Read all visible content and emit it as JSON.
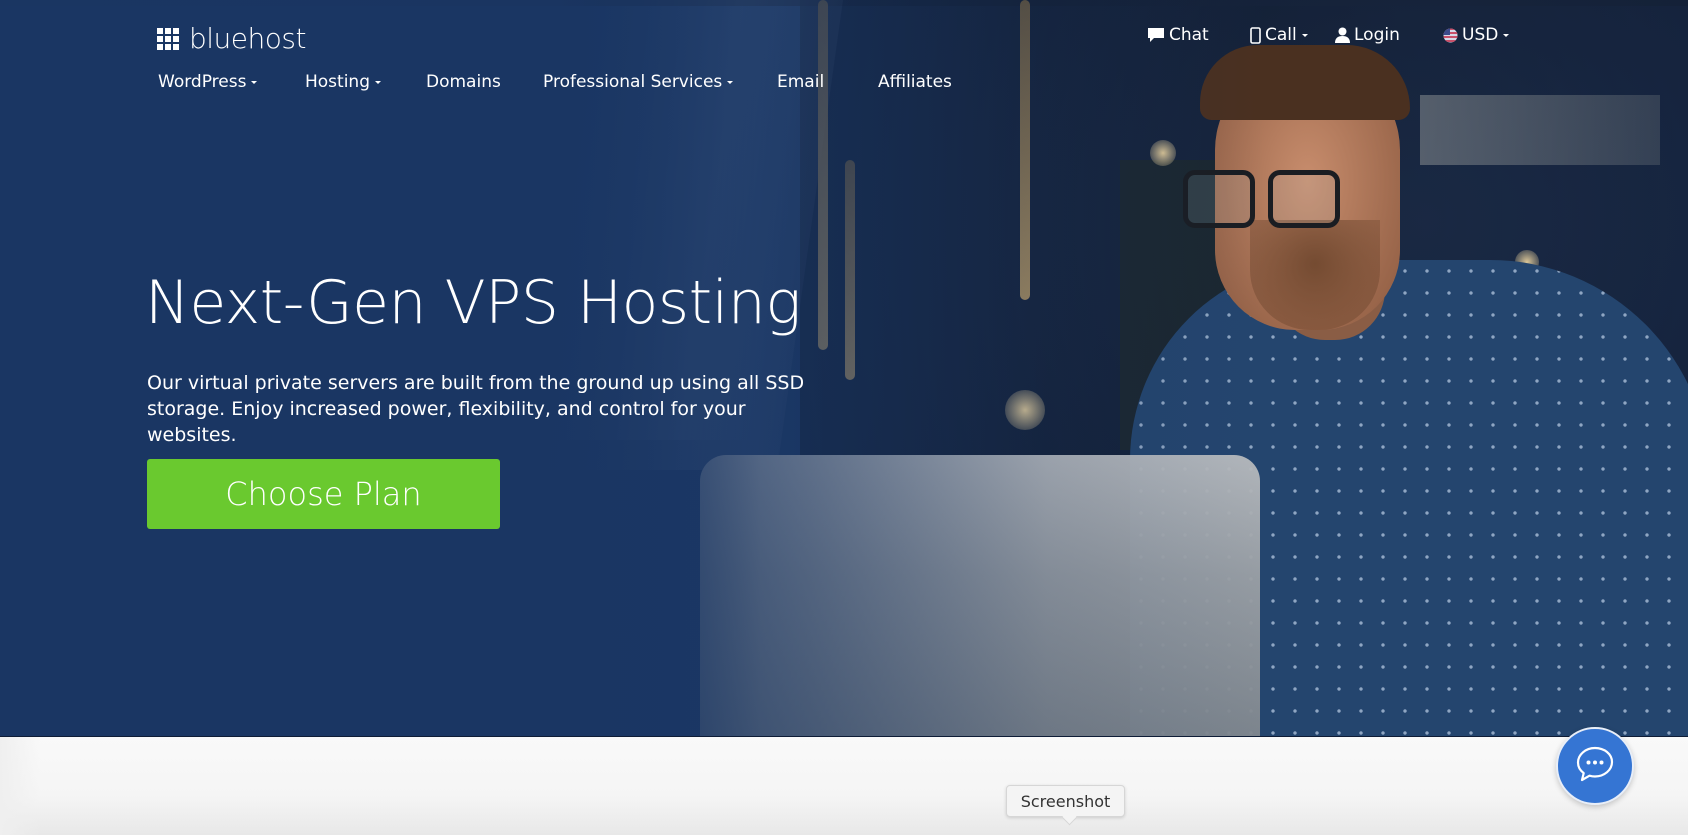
{
  "brand": {
    "name": "bluehost",
    "logo_icon": "grid-3x3-icon"
  },
  "utility_nav": {
    "chat": {
      "label": "Chat",
      "icon": "chat-bubble-icon"
    },
    "call": {
      "label": "Call",
      "icon": "mobile-phone-icon",
      "has_dropdown": true
    },
    "login": {
      "label": "Login",
      "icon": "user-icon"
    },
    "currency": {
      "label": "USD",
      "icon": "us-flag-icon",
      "has_dropdown": true
    }
  },
  "main_nav": {
    "items": [
      {
        "label": "WordPress",
        "has_dropdown": true
      },
      {
        "label": "Hosting",
        "has_dropdown": true
      },
      {
        "label": "Domains",
        "has_dropdown": false
      },
      {
        "label": "Professional Services",
        "has_dropdown": true
      },
      {
        "label": "Email",
        "has_dropdown": false
      },
      {
        "label": "Affiliates",
        "has_dropdown": false
      }
    ]
  },
  "hero": {
    "title": "Next-Gen VPS Hosting",
    "subtitle_line1": "Our virtual private servers are built from the ground up using all SSD",
    "subtitle_line2": "storage. Enjoy increased power, flexibility, and control for your websites.",
    "cta_label": "Choose Plan",
    "background_image": "man-with-glasses-using-laptop-photo"
  },
  "tooltip": {
    "label": "Screenshot"
  },
  "chat_widget": {
    "icon": "chat-ellipsis-icon"
  },
  "colors": {
    "hero_blue": "#1a3663",
    "cta_green": "#6ac92f",
    "chat_blue": "#3575d3",
    "page_bg": "#f7f7f7"
  }
}
